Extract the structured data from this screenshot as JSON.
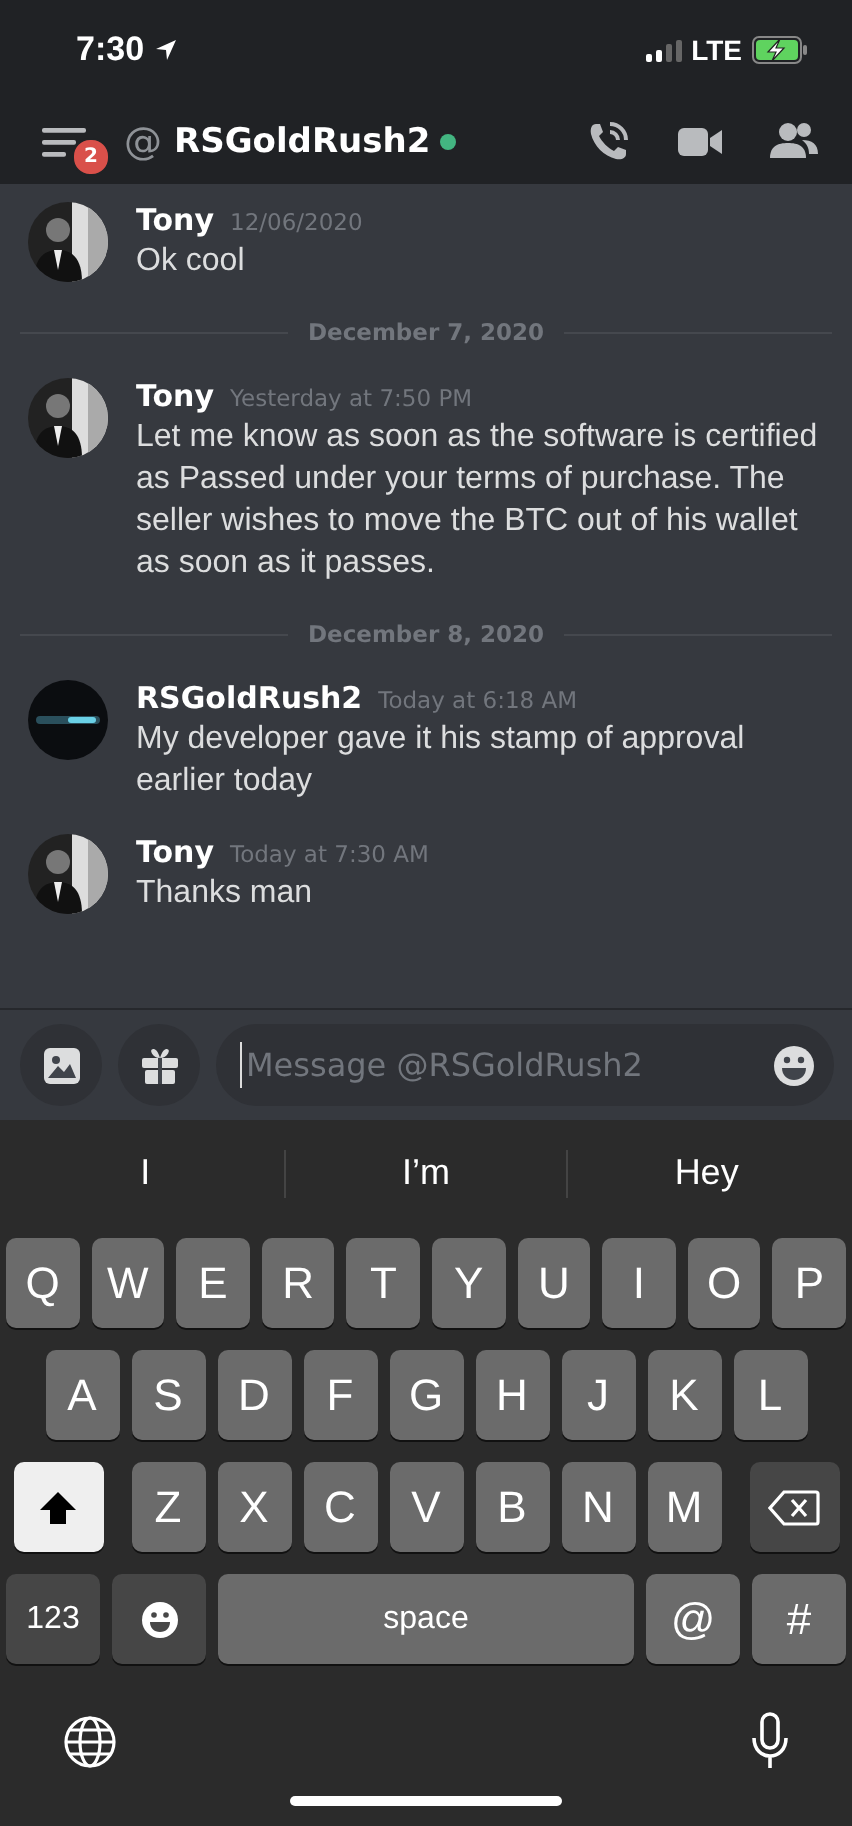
{
  "status_bar": {
    "time": "7:30",
    "network": "LTE"
  },
  "header": {
    "unread_badge": "2",
    "at_sign": "@",
    "title": "RSGoldRush2",
    "online": true
  },
  "messages": [
    {
      "kind": "message",
      "author": "Tony",
      "time": "12/06/2020",
      "text": "Ok cool"
    },
    {
      "kind": "divider",
      "text": "December 7, 2020"
    },
    {
      "kind": "message",
      "author": "Tony",
      "time": "Yesterday at 7:50 PM",
      "text": "Let me know as soon as the software is certified as Passed under your terms of purchase. The seller wishes to move the BTC out of his wallet as soon as it passes."
    },
    {
      "kind": "divider",
      "text": "December 8, 2020"
    },
    {
      "kind": "message",
      "author": "RSGoldRush2",
      "time": "Today at 6:18 AM",
      "text": "My developer gave it his stamp of approval earlier today"
    },
    {
      "kind": "message",
      "author": "Tony",
      "time": "Today at 7:30 AM",
      "text": "Thanks man"
    }
  ],
  "composer": {
    "placeholder": "Message @RSGoldRush2"
  },
  "keyboard": {
    "suggestions": [
      "I",
      "I’m",
      "Hey"
    ],
    "rows": [
      {
        "keys": [
          {
            "kind": "letter",
            "label": "Q"
          },
          {
            "kind": "letter",
            "label": "W"
          },
          {
            "kind": "letter",
            "label": "E"
          },
          {
            "kind": "letter",
            "label": "R"
          },
          {
            "kind": "letter",
            "label": "T"
          },
          {
            "kind": "letter",
            "label": "Y"
          },
          {
            "kind": "letter",
            "label": "U"
          },
          {
            "kind": "letter",
            "label": "I"
          },
          {
            "kind": "letter",
            "label": "O"
          },
          {
            "kind": "letter",
            "label": "P"
          }
        ]
      },
      {
        "keys": [
          {
            "kind": "letter",
            "label": "A"
          },
          {
            "kind": "letter",
            "label": "S"
          },
          {
            "kind": "letter",
            "label": "D"
          },
          {
            "kind": "letter",
            "label": "F"
          },
          {
            "kind": "letter",
            "label": "G"
          },
          {
            "kind": "letter",
            "label": "H"
          },
          {
            "kind": "letter",
            "label": "J"
          },
          {
            "kind": "letter",
            "label": "K"
          },
          {
            "kind": "letter",
            "label": "L"
          }
        ]
      },
      {
        "keys": [
          {
            "kind": "shift",
            "on": true
          },
          {
            "kind": "letter",
            "label": "Z"
          },
          {
            "kind": "letter",
            "label": "X"
          },
          {
            "kind": "letter",
            "label": "C"
          },
          {
            "kind": "letter",
            "label": "V"
          },
          {
            "kind": "letter",
            "label": "B"
          },
          {
            "kind": "letter",
            "label": "N"
          },
          {
            "kind": "letter",
            "label": "M"
          },
          {
            "kind": "backspace"
          }
        ]
      },
      {
        "keys": [
          {
            "kind": "mode",
            "label": "123"
          },
          {
            "kind": "emoji"
          },
          {
            "kind": "space",
            "label": "space"
          },
          {
            "kind": "symbol",
            "label": "@"
          },
          {
            "kind": "symbol",
            "label": "#"
          }
        ]
      }
    ]
  }
}
